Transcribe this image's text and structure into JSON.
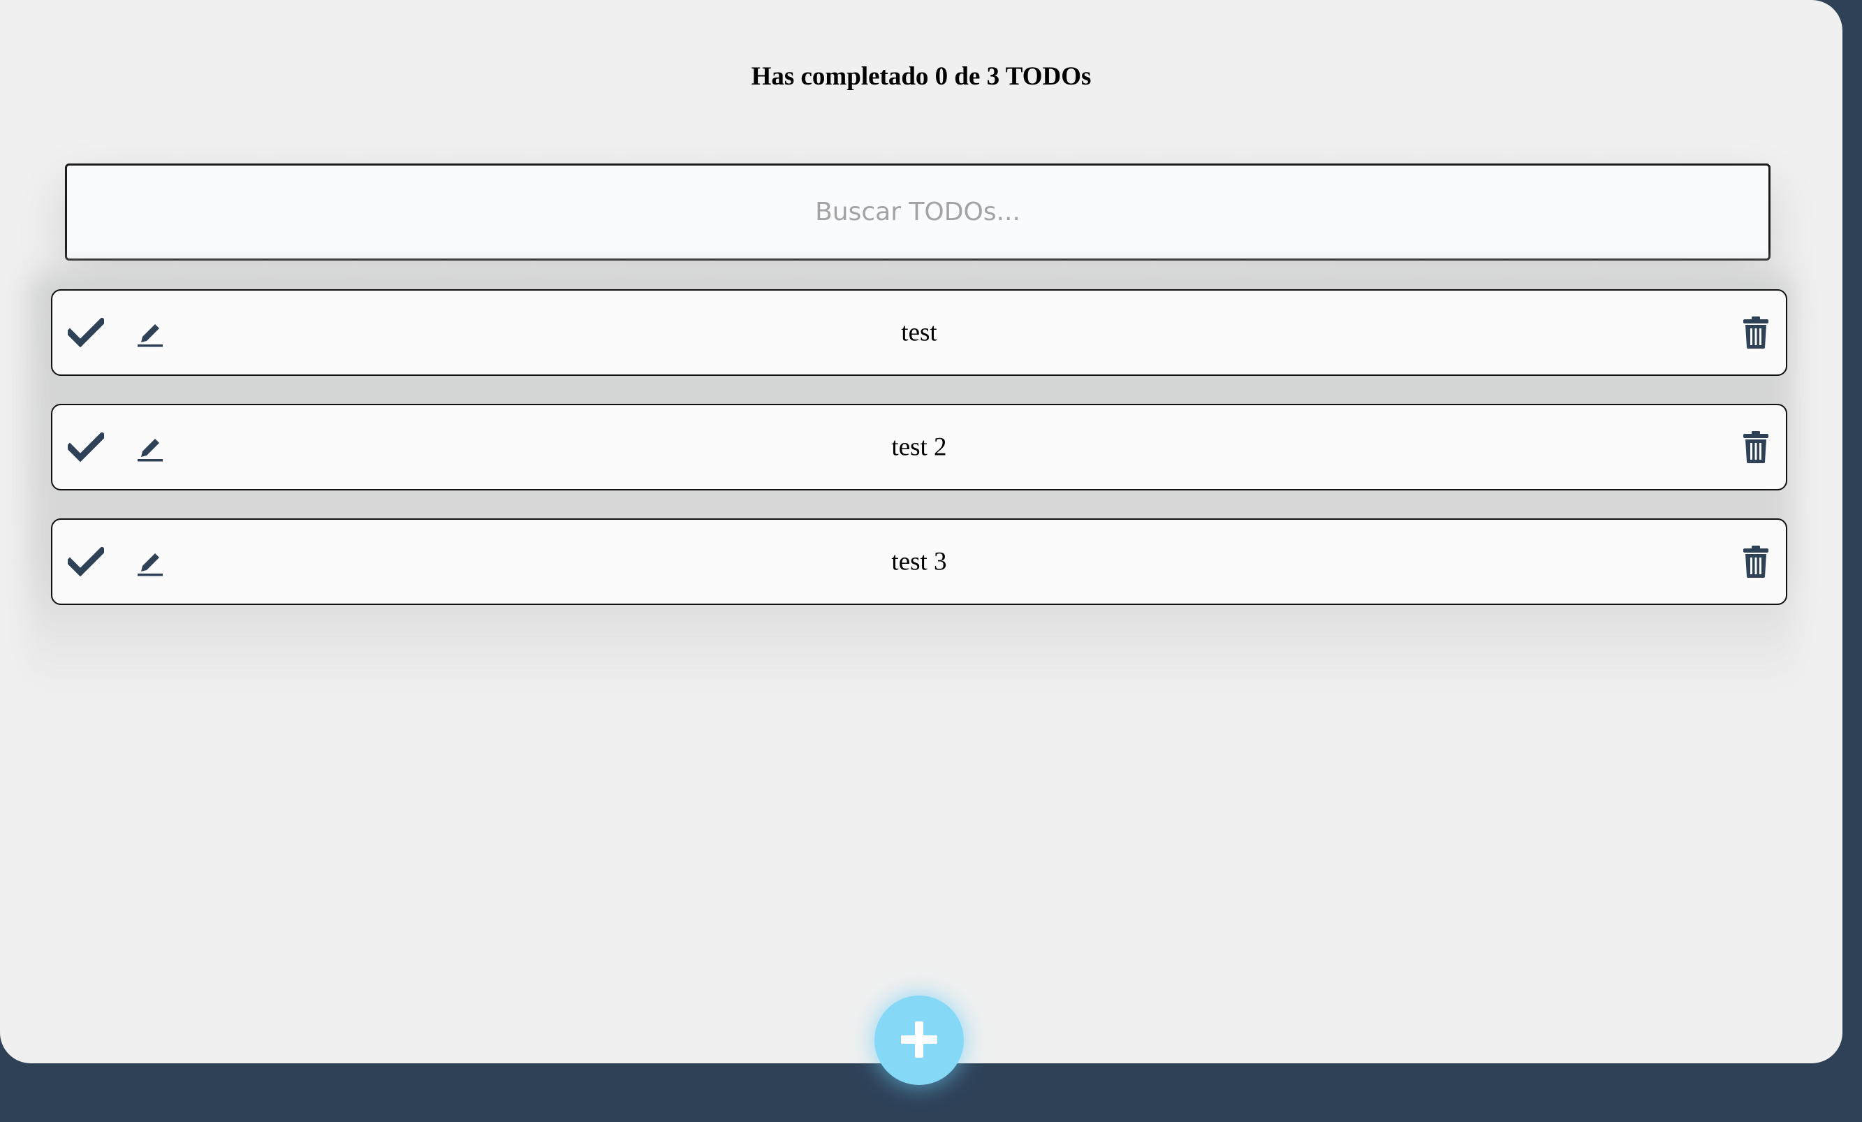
{
  "header": {
    "counter_text": "Has completado 0 de 3 TODOs"
  },
  "search": {
    "placeholder": "Buscar TODOs...",
    "value": ""
  },
  "todos": [
    {
      "text": "test",
      "completed": false
    },
    {
      "text": "test 2",
      "completed": false
    },
    {
      "text": "test 3",
      "completed": false
    }
  ],
  "icons": {
    "complete": "check-icon",
    "edit": "pencil-icon",
    "delete": "trash-icon",
    "add": "plus-icon"
  },
  "colors": {
    "page_background": "#2e4157",
    "card_background": "#f0f0f0",
    "icon_color": "#2e4157",
    "add_button": "#86d8f7"
  }
}
